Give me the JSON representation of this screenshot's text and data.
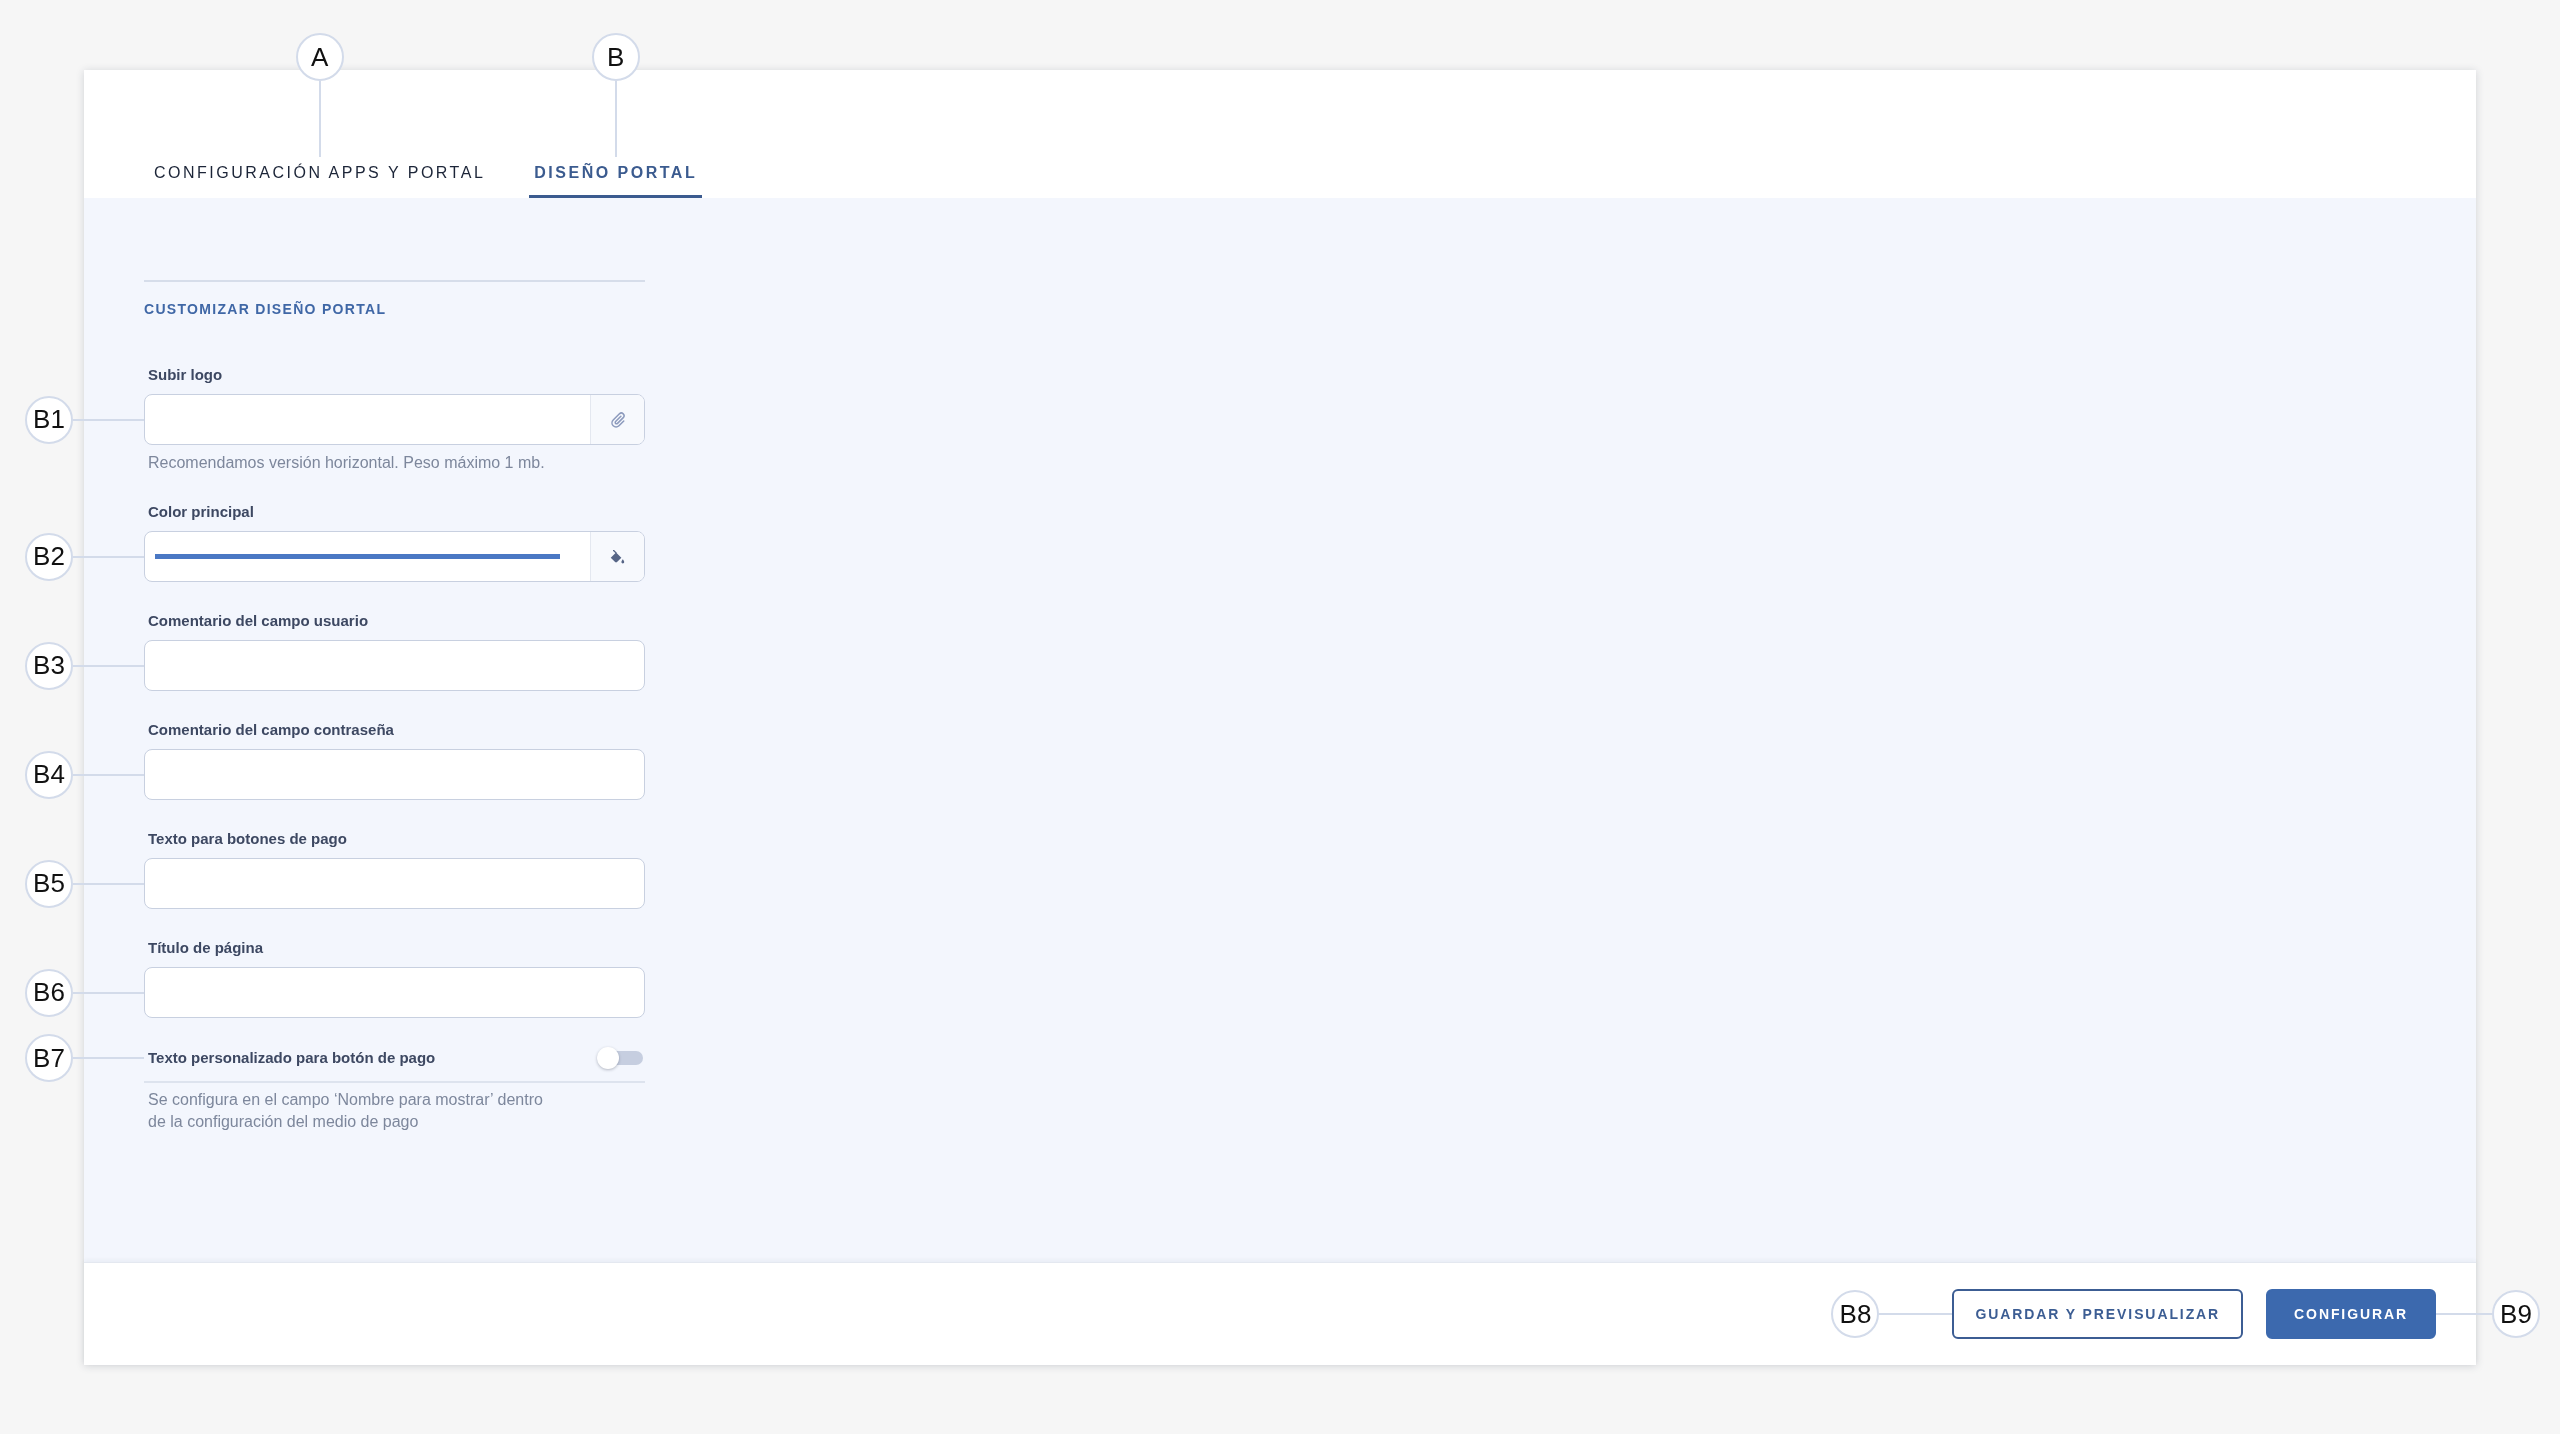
{
  "tabs": [
    {
      "label": "CONFIGURACIÓN APPS Y PORTAL",
      "selected": false,
      "callout": "A"
    },
    {
      "label": "DISEÑO PORTAL",
      "selected": true,
      "callout": "B"
    }
  ],
  "section": {
    "title": "CUSTOMIZAR DISEÑO PORTAL",
    "fields": [
      {
        "kind": "file",
        "label": "Subir logo",
        "hint": "Recomendamos versión horizontal. Peso máximo 1 mb.",
        "callout": "B1"
      },
      {
        "kind": "color",
        "label": "Color principal",
        "color": "#4a78c4",
        "callout": "B2"
      },
      {
        "kind": "text",
        "label": "Comentario del campo usuario",
        "callout": "B3"
      },
      {
        "kind": "text",
        "label": "Comentario del campo contraseña",
        "callout": "B4"
      },
      {
        "kind": "text",
        "label": "Texto para botones de pago",
        "callout": "B5"
      },
      {
        "kind": "text",
        "label": "Título de página",
        "callout": "B6"
      },
      {
        "kind": "toggle",
        "label": "Texto personalizado para botón de pago",
        "on": false,
        "hint": "Se configura en el campo ‘Nombre para mostrar’ dentro de la configuración del medio de pago",
        "callout": "B7"
      }
    ]
  },
  "footer": {
    "buttons": [
      {
        "kind": "secondary",
        "label": "GUARDAR Y PREVISUALIZAR",
        "callout": "B8"
      },
      {
        "kind": "primary",
        "label": "CONFIGURAR",
        "callout": "B9"
      }
    ]
  }
}
